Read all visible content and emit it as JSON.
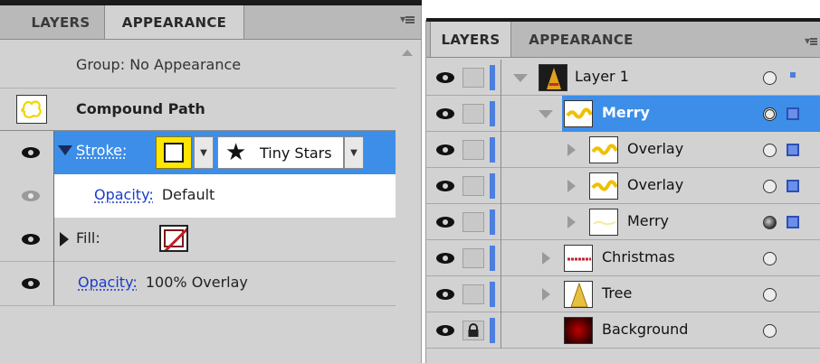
{
  "appearance_panel": {
    "tabs": [
      "LAYERS",
      "APPEARANCE"
    ],
    "group_label": "Group: No Appearance",
    "object_title": "Compound Path",
    "stroke": {
      "label": "Stroke:",
      "brush_icon": "star-icon",
      "brush_name": "Tiny Stars"
    },
    "stroke_opacity": {
      "label": "Opacity:",
      "value": "Default"
    },
    "fill": {
      "label": "Fill:"
    },
    "fill_opacity": {
      "label": "Opacity:",
      "value": "100% Overlay"
    }
  },
  "layers_panel": {
    "tabs": [
      "LAYERS",
      "APPEARANCE"
    ],
    "rows": [
      {
        "name": "Layer 1"
      },
      {
        "name": "Merry"
      },
      {
        "name": "Overlay"
      },
      {
        "name": "Overlay"
      },
      {
        "name": "Merry"
      },
      {
        "name": "Christmas"
      },
      {
        "name": "Tree"
      },
      {
        "name": "Background"
      }
    ]
  },
  "colors": {
    "panel_bg": "#d2d2d2",
    "tab_bg": "#b9b9b9",
    "selection_blue": "#3d8ee8",
    "accent_blue": "#4d7fe0",
    "stroke_swatch_yellow": "#ffe600",
    "link_blue": "#1b3cc9"
  }
}
